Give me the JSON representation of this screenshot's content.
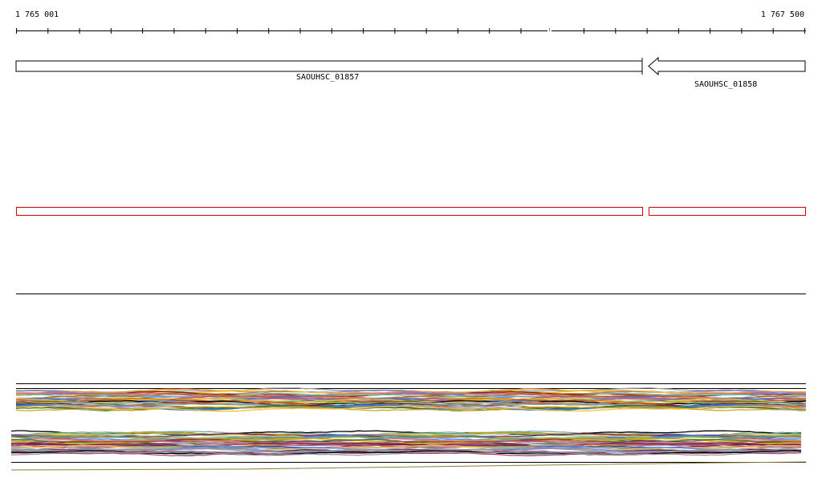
{
  "ruler": {
    "start_label": "1 765 001",
    "end_label": "1 767 500"
  },
  "genes": [
    {
      "label": "SAOUHSC_01857",
      "strand": "forward"
    },
    {
      "label": "SAOUHSC_01858",
      "strand": "reverse"
    }
  ],
  "colors": {
    "gene_outline": "#000000",
    "feature_outline": "#cc0000",
    "track_line": "#000000",
    "tick_gap_marker": "#cc6666"
  },
  "coverage_palette": [
    "#d4a017",
    "#6aa84f",
    "#3c78d8",
    "#cc4125",
    "#8e7cc3",
    "#e06666",
    "#76a5af",
    "#b45f06",
    "#38761d",
    "#741b47",
    "#a64d79",
    "#f1c232",
    "#999999",
    "#000000",
    "#4a86e8",
    "#93c47d",
    "#e69138",
    "#c27ba0"
  ]
}
